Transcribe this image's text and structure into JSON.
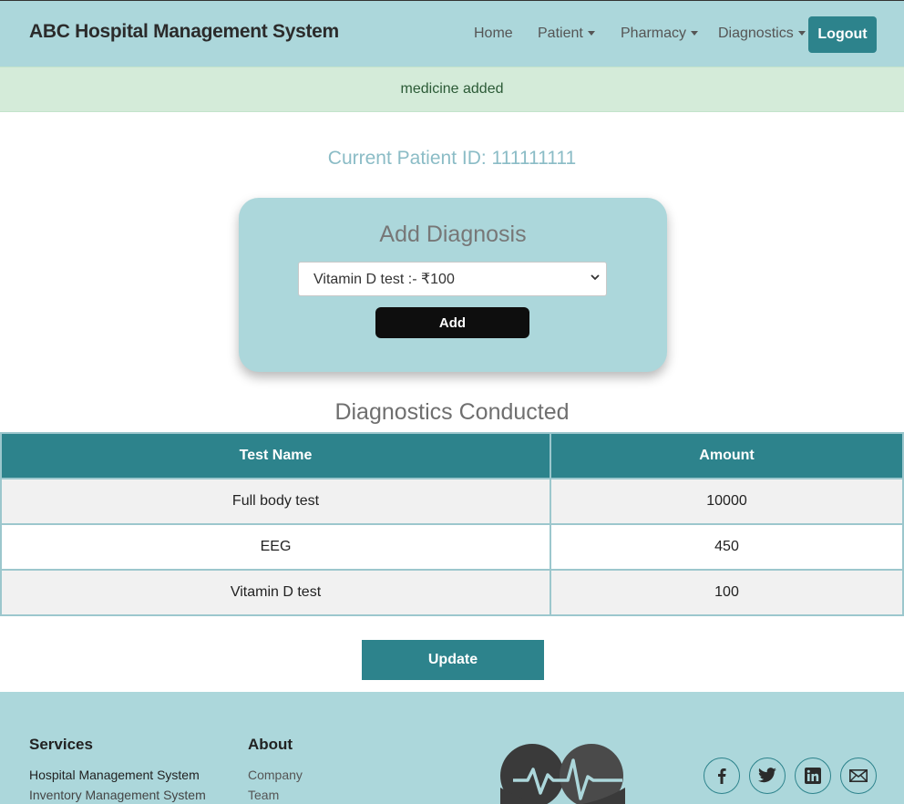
{
  "app": {
    "title": "ABC Hospital Management System"
  },
  "nav": {
    "home": "Home",
    "patient": "Patient",
    "pharmacy": "Pharmacy",
    "diagnostics": "Diagnostics",
    "logout": "Logout"
  },
  "alert": {
    "message": "medicine added"
  },
  "patient": {
    "label": "Current Patient ID: 111111111"
  },
  "add_diagnosis": {
    "title": "Add Diagnosis",
    "selected_option": "Vitamin D test :- ₹100",
    "add_label": "Add"
  },
  "diagnostics": {
    "title": "Diagnostics Conducted",
    "columns": [
      "Test Name",
      "Amount"
    ],
    "rows": [
      {
        "name": "Full body test",
        "amount": "10000"
      },
      {
        "name": "EEG",
        "amount": "450"
      },
      {
        "name": "Vitamin D test",
        "amount": "100"
      }
    ],
    "update_label": "Update"
  },
  "footer": {
    "services": {
      "heading": "Services",
      "links": [
        "Hospital Management System",
        "Inventory Management System"
      ]
    },
    "about": {
      "heading": "About",
      "links": [
        "Company",
        "Team"
      ]
    },
    "logo_icon": "heart-pulse-icon",
    "social_icons": [
      "facebook-icon",
      "twitter-icon",
      "linkedin-icon",
      "mail-icon"
    ]
  },
  "colors": {
    "navbar_bg": "#acd7db",
    "accent": "#2d838c",
    "alert_bg": "#d4ebd9",
    "patient_id_text": "#8bbcc6",
    "add_button_bg": "#0e0e0e"
  }
}
